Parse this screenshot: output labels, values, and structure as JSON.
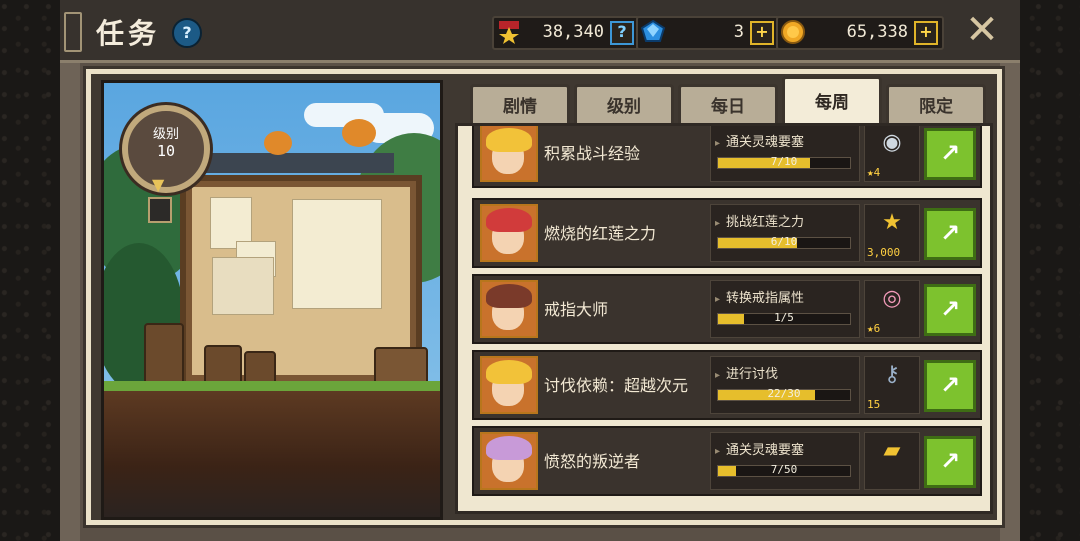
{
  "header": {
    "title": "任务",
    "help": "?",
    "resources": [
      {
        "icon": "medal-icon",
        "amount": "38,340",
        "button": "?"
      },
      {
        "icon": "gem-icon",
        "amount": "3",
        "button": "+"
      },
      {
        "icon": "gold-coin-icon",
        "amount": "65,338",
        "button": "+"
      }
    ],
    "close": "✕"
  },
  "scene": {
    "level_label": "级别",
    "level_value": "10"
  },
  "tabs": [
    {
      "label": "剧情",
      "active": false
    },
    {
      "label": "级别",
      "active": false
    },
    {
      "label": "每日",
      "active": false
    },
    {
      "label": "每周",
      "active": true
    },
    {
      "label": "限定",
      "active": false
    }
  ],
  "quests": [
    {
      "name": "积累战斗经验",
      "task": "通关灵魂要塞",
      "progress": "7/10",
      "fraction": 0.7,
      "reward_icon": "robot-icon",
      "reward_glyph": "◉",
      "reward_qty": "★4",
      "hair": "#f2c239"
    },
    {
      "name": "燃烧的红莲之力",
      "task": "挑战红莲之力",
      "progress": "6/10",
      "fraction": 0.6,
      "reward_icon": "medal-icon",
      "reward_glyph": "★",
      "reward_qty": "3,000",
      "hair": "#d13b3b"
    },
    {
      "name": "戒指大师",
      "task": "转换戒指属性",
      "progress": "1/5",
      "fraction": 0.2,
      "reward_icon": "donut-icon",
      "reward_glyph": "◎",
      "reward_qty": "★6",
      "hair": "#7a3a2a"
    },
    {
      "name": "讨伐依赖：超越次元",
      "task": "进行讨伐",
      "progress": "22/30",
      "fraction": 0.733,
      "reward_icon": "key-icon",
      "reward_glyph": "⚷",
      "reward_qty": "15",
      "hair": "#f2c239"
    },
    {
      "name": "愤怒的叛逆者",
      "task": "通关灵魂要塞",
      "progress": "7/50",
      "fraction": 0.14,
      "reward_icon": "ticket-icon",
      "reward_glyph": "▰",
      "reward_qty": "",
      "hair": "#c89ad8"
    }
  ],
  "go_glyph": "↗",
  "colors": {
    "go": "#7dc22e",
    "progress": "#e6be2c",
    "accent": "#d6c6a2"
  }
}
